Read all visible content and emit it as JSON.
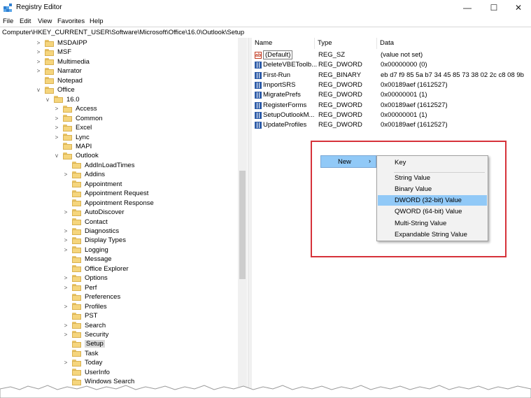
{
  "window": {
    "title": "Registry Editor",
    "minimize": "—",
    "maximize": "☐",
    "close": "✕"
  },
  "menu": [
    "File",
    "Edit",
    "View",
    "Favorites",
    "Help"
  ],
  "address": "Computer\\HKEY_CURRENT_USER\\Software\\Microsoft\\Office\\16.0\\Outlook\\Setup",
  "tree": [
    {
      "label": "MSDAIPP",
      "level": 0,
      "expander": ">"
    },
    {
      "label": "MSF",
      "level": 0,
      "expander": ">"
    },
    {
      "label": "Multimedia",
      "level": 0,
      "expander": ">"
    },
    {
      "label": "Narrator",
      "level": 0,
      "expander": ">"
    },
    {
      "label": "Notepad",
      "level": 0,
      "expander": ""
    },
    {
      "label": "Office",
      "level": 0,
      "expander": "v"
    },
    {
      "label": "16.0",
      "level": 1,
      "expander": "v"
    },
    {
      "label": "Access",
      "level": 2,
      "expander": ">"
    },
    {
      "label": "Common",
      "level": 2,
      "expander": ">"
    },
    {
      "label": "Excel",
      "level": 2,
      "expander": ">"
    },
    {
      "label": "Lync",
      "level": 2,
      "expander": ">"
    },
    {
      "label": "MAPI",
      "level": 2,
      "expander": ""
    },
    {
      "label": "Outlook",
      "level": 2,
      "expander": "v"
    },
    {
      "label": "AddInLoadTimes",
      "level": 3,
      "expander": ""
    },
    {
      "label": "Addins",
      "level": 3,
      "expander": ">"
    },
    {
      "label": "Appointment",
      "level": 3,
      "expander": ""
    },
    {
      "label": "Appointment Request",
      "level": 3,
      "expander": ""
    },
    {
      "label": "Appointment Response",
      "level": 3,
      "expander": ""
    },
    {
      "label": "AutoDiscover",
      "level": 3,
      "expander": ">"
    },
    {
      "label": "Contact",
      "level": 3,
      "expander": ""
    },
    {
      "label": "Diagnostics",
      "level": 3,
      "expander": ">"
    },
    {
      "label": "Display Types",
      "level": 3,
      "expander": ">"
    },
    {
      "label": "Logging",
      "level": 3,
      "expander": ">"
    },
    {
      "label": "Message",
      "level": 3,
      "expander": ""
    },
    {
      "label": "Office Explorer",
      "level": 3,
      "expander": ""
    },
    {
      "label": "Options",
      "level": 3,
      "expander": ">"
    },
    {
      "label": "Perf",
      "level": 3,
      "expander": ">"
    },
    {
      "label": "Preferences",
      "level": 3,
      "expander": ""
    },
    {
      "label": "Profiles",
      "level": 3,
      "expander": ">"
    },
    {
      "label": "PST",
      "level": 3,
      "expander": ""
    },
    {
      "label": "Search",
      "level": 3,
      "expander": ">"
    },
    {
      "label": "Security",
      "level": 3,
      "expander": ">"
    },
    {
      "label": "Setup",
      "level": 3,
      "expander": "",
      "selected": true
    },
    {
      "label": "Task",
      "level": 3,
      "expander": ""
    },
    {
      "label": "Today",
      "level": 3,
      "expander": ">"
    },
    {
      "label": "UserInfo",
      "level": 3,
      "expander": ""
    },
    {
      "label": "Windows Search",
      "level": 3,
      "expander": ""
    }
  ],
  "columns": [
    "Name",
    "Type",
    "Data"
  ],
  "values": [
    {
      "name": "(Default)",
      "type": "REG_SZ",
      "data": "(value not set)",
      "icon": "string-value-icon"
    },
    {
      "name": "DeleteVBEToolb...",
      "type": "REG_DWORD",
      "data": "0x00000000 (0)",
      "icon": "binary-value-icon"
    },
    {
      "name": "First-Run",
      "type": "REG_BINARY",
      "data": "eb d7 f9 85 5a b7 34 45 85 73 38 02 2c c8 08 9b",
      "icon": "binary-value-icon"
    },
    {
      "name": "ImportSRS",
      "type": "REG_DWORD",
      "data": "0x00189aef (1612527)",
      "icon": "binary-value-icon"
    },
    {
      "name": "MigratePrefs",
      "type": "REG_DWORD",
      "data": "0x00000001 (1)",
      "icon": "binary-value-icon"
    },
    {
      "name": "RegisterForms",
      "type": "REG_DWORD",
      "data": "0x00189aef (1612527)",
      "icon": "binary-value-icon"
    },
    {
      "name": "SetupOutlookM...",
      "type": "REG_DWORD",
      "data": "0x00000001 (1)",
      "icon": "binary-value-icon"
    },
    {
      "name": "UpdateProfiles",
      "type": "REG_DWORD",
      "data": "0x00189aef (1612527)",
      "icon": "binary-value-icon"
    }
  ],
  "context_menu": {
    "new_label": "New",
    "arrow": "›",
    "submenu": [
      "Key",
      "String Value",
      "Binary Value",
      "DWORD (32-bit) Value",
      "QWORD (64-bit) Value",
      "Multi-String Value",
      "Expandable String Value"
    ],
    "active_index": 3
  },
  "colors": {
    "highlight_border": "#d6323a",
    "menu_hover": "#91c9f7"
  }
}
